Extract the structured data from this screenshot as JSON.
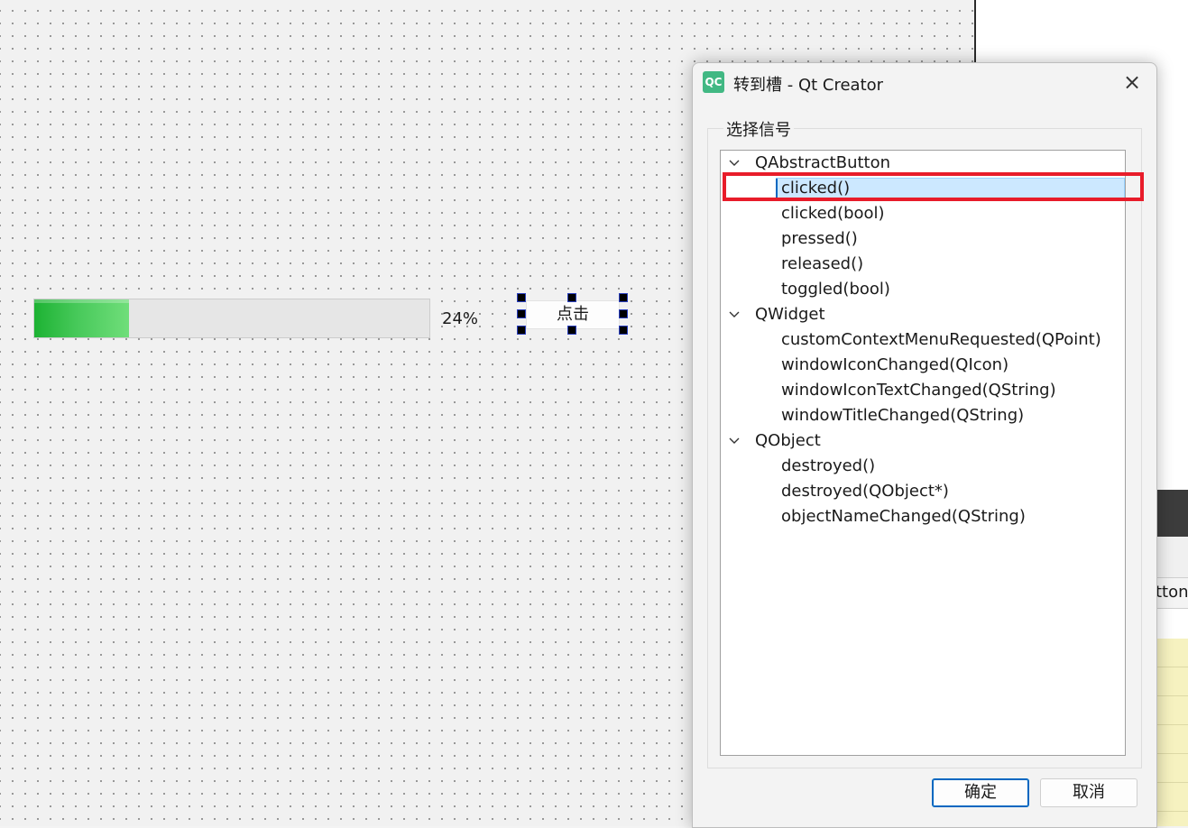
{
  "progress_bar": {
    "value_percent": 24,
    "text": "24%",
    "fill_color": "#1db233"
  },
  "form_button": {
    "label": "点击"
  },
  "dialog": {
    "app_icon_text": "QC",
    "title": "转到槽 - Qt Creator",
    "close_icon": "×",
    "group_label": "选择信号",
    "tree": [
      {
        "label": "QAbstractButton",
        "children": [
          "clicked()",
          "clicked(bool)",
          "pressed()",
          "released()",
          "toggled(bool)"
        ]
      },
      {
        "label": "QWidget",
        "children": [
          "customContextMenuRequested(QPoint)",
          "windowIconChanged(QIcon)",
          "windowIconTextChanged(QString)",
          "windowTitleChanged(QString)"
        ]
      },
      {
        "label": "QObject",
        "children": [
          "destroyed()",
          "destroyed(QObject*)",
          "objectNameChanged(QString)"
        ]
      }
    ],
    "selected_signal": "clicked()",
    "highlight_color": "#e81c2a",
    "ok_label": "确定",
    "cancel_label": "取消"
  },
  "right_panel": {
    "partial_button_text": "itton"
  }
}
